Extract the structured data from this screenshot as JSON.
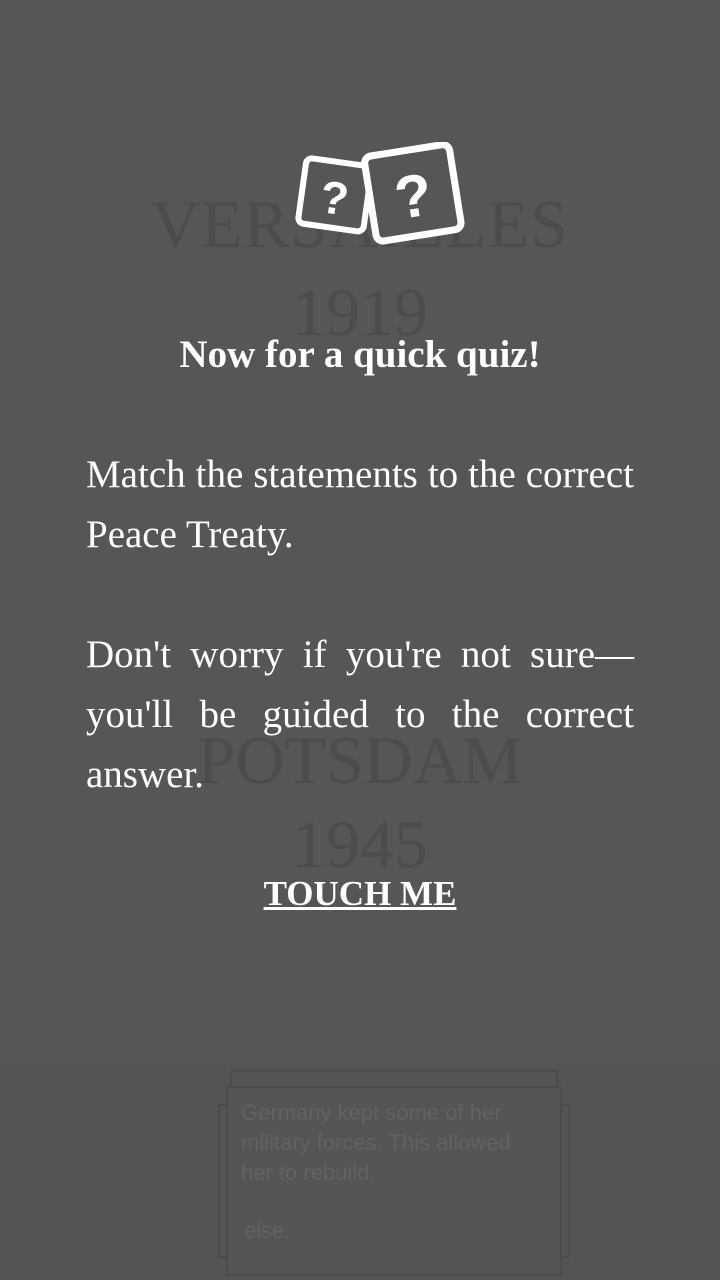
{
  "background": {
    "treaty_1_name": "VERSAILLES",
    "treaty_1_year": "1919",
    "treaty_2_name": "POTSDAM",
    "treaty_2_year": "1945",
    "card_text": "Germany kept some of her military forces. This allowed her to rebuild.",
    "card_text_trailing": "else."
  },
  "overlay": {
    "icon": "quiz-question-cards-icon",
    "headline": "Now for a quick quiz!",
    "paragraph_1": "Match the statements to the correct Peace Treaty.",
    "paragraph_2": "Don't worry if you're not sure— you'll be guided to the correct answer.",
    "button_label": "TOUCH ME"
  },
  "colors": {
    "overlay_bg": "#565657",
    "text": "#ffffff"
  }
}
